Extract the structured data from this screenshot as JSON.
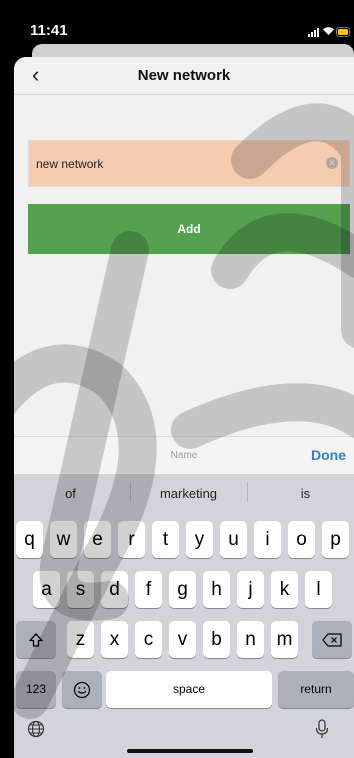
{
  "status_bar": {
    "time": "11:41"
  },
  "nav": {
    "title": "New network",
    "back_icon": "chevron-left-icon"
  },
  "form": {
    "name_value": "new network",
    "add_label": "Add"
  },
  "accessory": {
    "field_label": "Name",
    "done_label": "Done"
  },
  "keyboard": {
    "suggestions": [
      "of",
      "marketing",
      "is"
    ],
    "row1": [
      "q",
      "w",
      "e",
      "r",
      "t",
      "y",
      "u",
      "i",
      "o",
      "p"
    ],
    "row2": [
      "a",
      "s",
      "d",
      "f",
      "g",
      "h",
      "j",
      "k",
      "l"
    ],
    "row3": [
      "z",
      "x",
      "c",
      "v",
      "b",
      "n",
      "m"
    ],
    "numbers_label": "123",
    "space_label": "space",
    "return_label": "return"
  },
  "colors": {
    "input_bg": "#f6ccb1",
    "add_button": "#54a24f",
    "done_text": "#2f80d1",
    "battery": "#f2c40b"
  }
}
